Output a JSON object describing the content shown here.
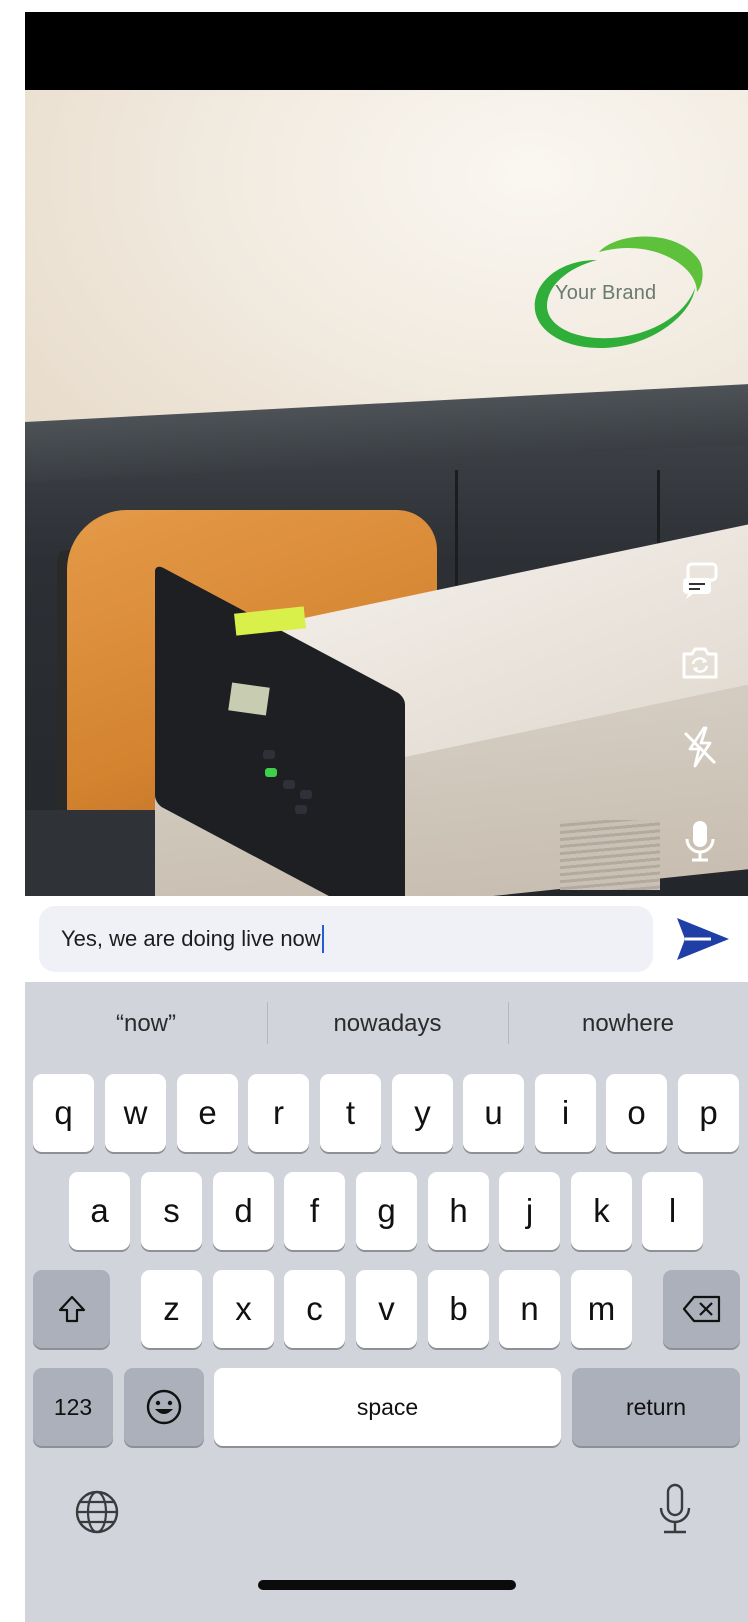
{
  "brand": {
    "logo_text": "Your Brand"
  },
  "chat": {
    "input_value": "Yes, we are doing live now"
  },
  "side_icons": [
    {
      "name": "chat-bubbles-icon"
    },
    {
      "name": "flip-camera-icon"
    },
    {
      "name": "flash-off-icon"
    },
    {
      "name": "microphone-icon"
    }
  ],
  "keyboard": {
    "suggestions": [
      "“now”",
      "nowadays",
      "nowhere"
    ],
    "row1": [
      "q",
      "w",
      "e",
      "r",
      "t",
      "y",
      "u",
      "i",
      "o",
      "p"
    ],
    "row2": [
      "a",
      "s",
      "d",
      "f",
      "g",
      "h",
      "j",
      "k",
      "l"
    ],
    "row3": [
      "z",
      "x",
      "c",
      "v",
      "b",
      "n",
      "m"
    ],
    "numbers_label": "123",
    "space_label": "space",
    "return_label": "return"
  },
  "colors": {
    "send_arrow": "#1f3fa6",
    "brand_green": "#2fae3a",
    "caret": "#2a5bd7"
  }
}
